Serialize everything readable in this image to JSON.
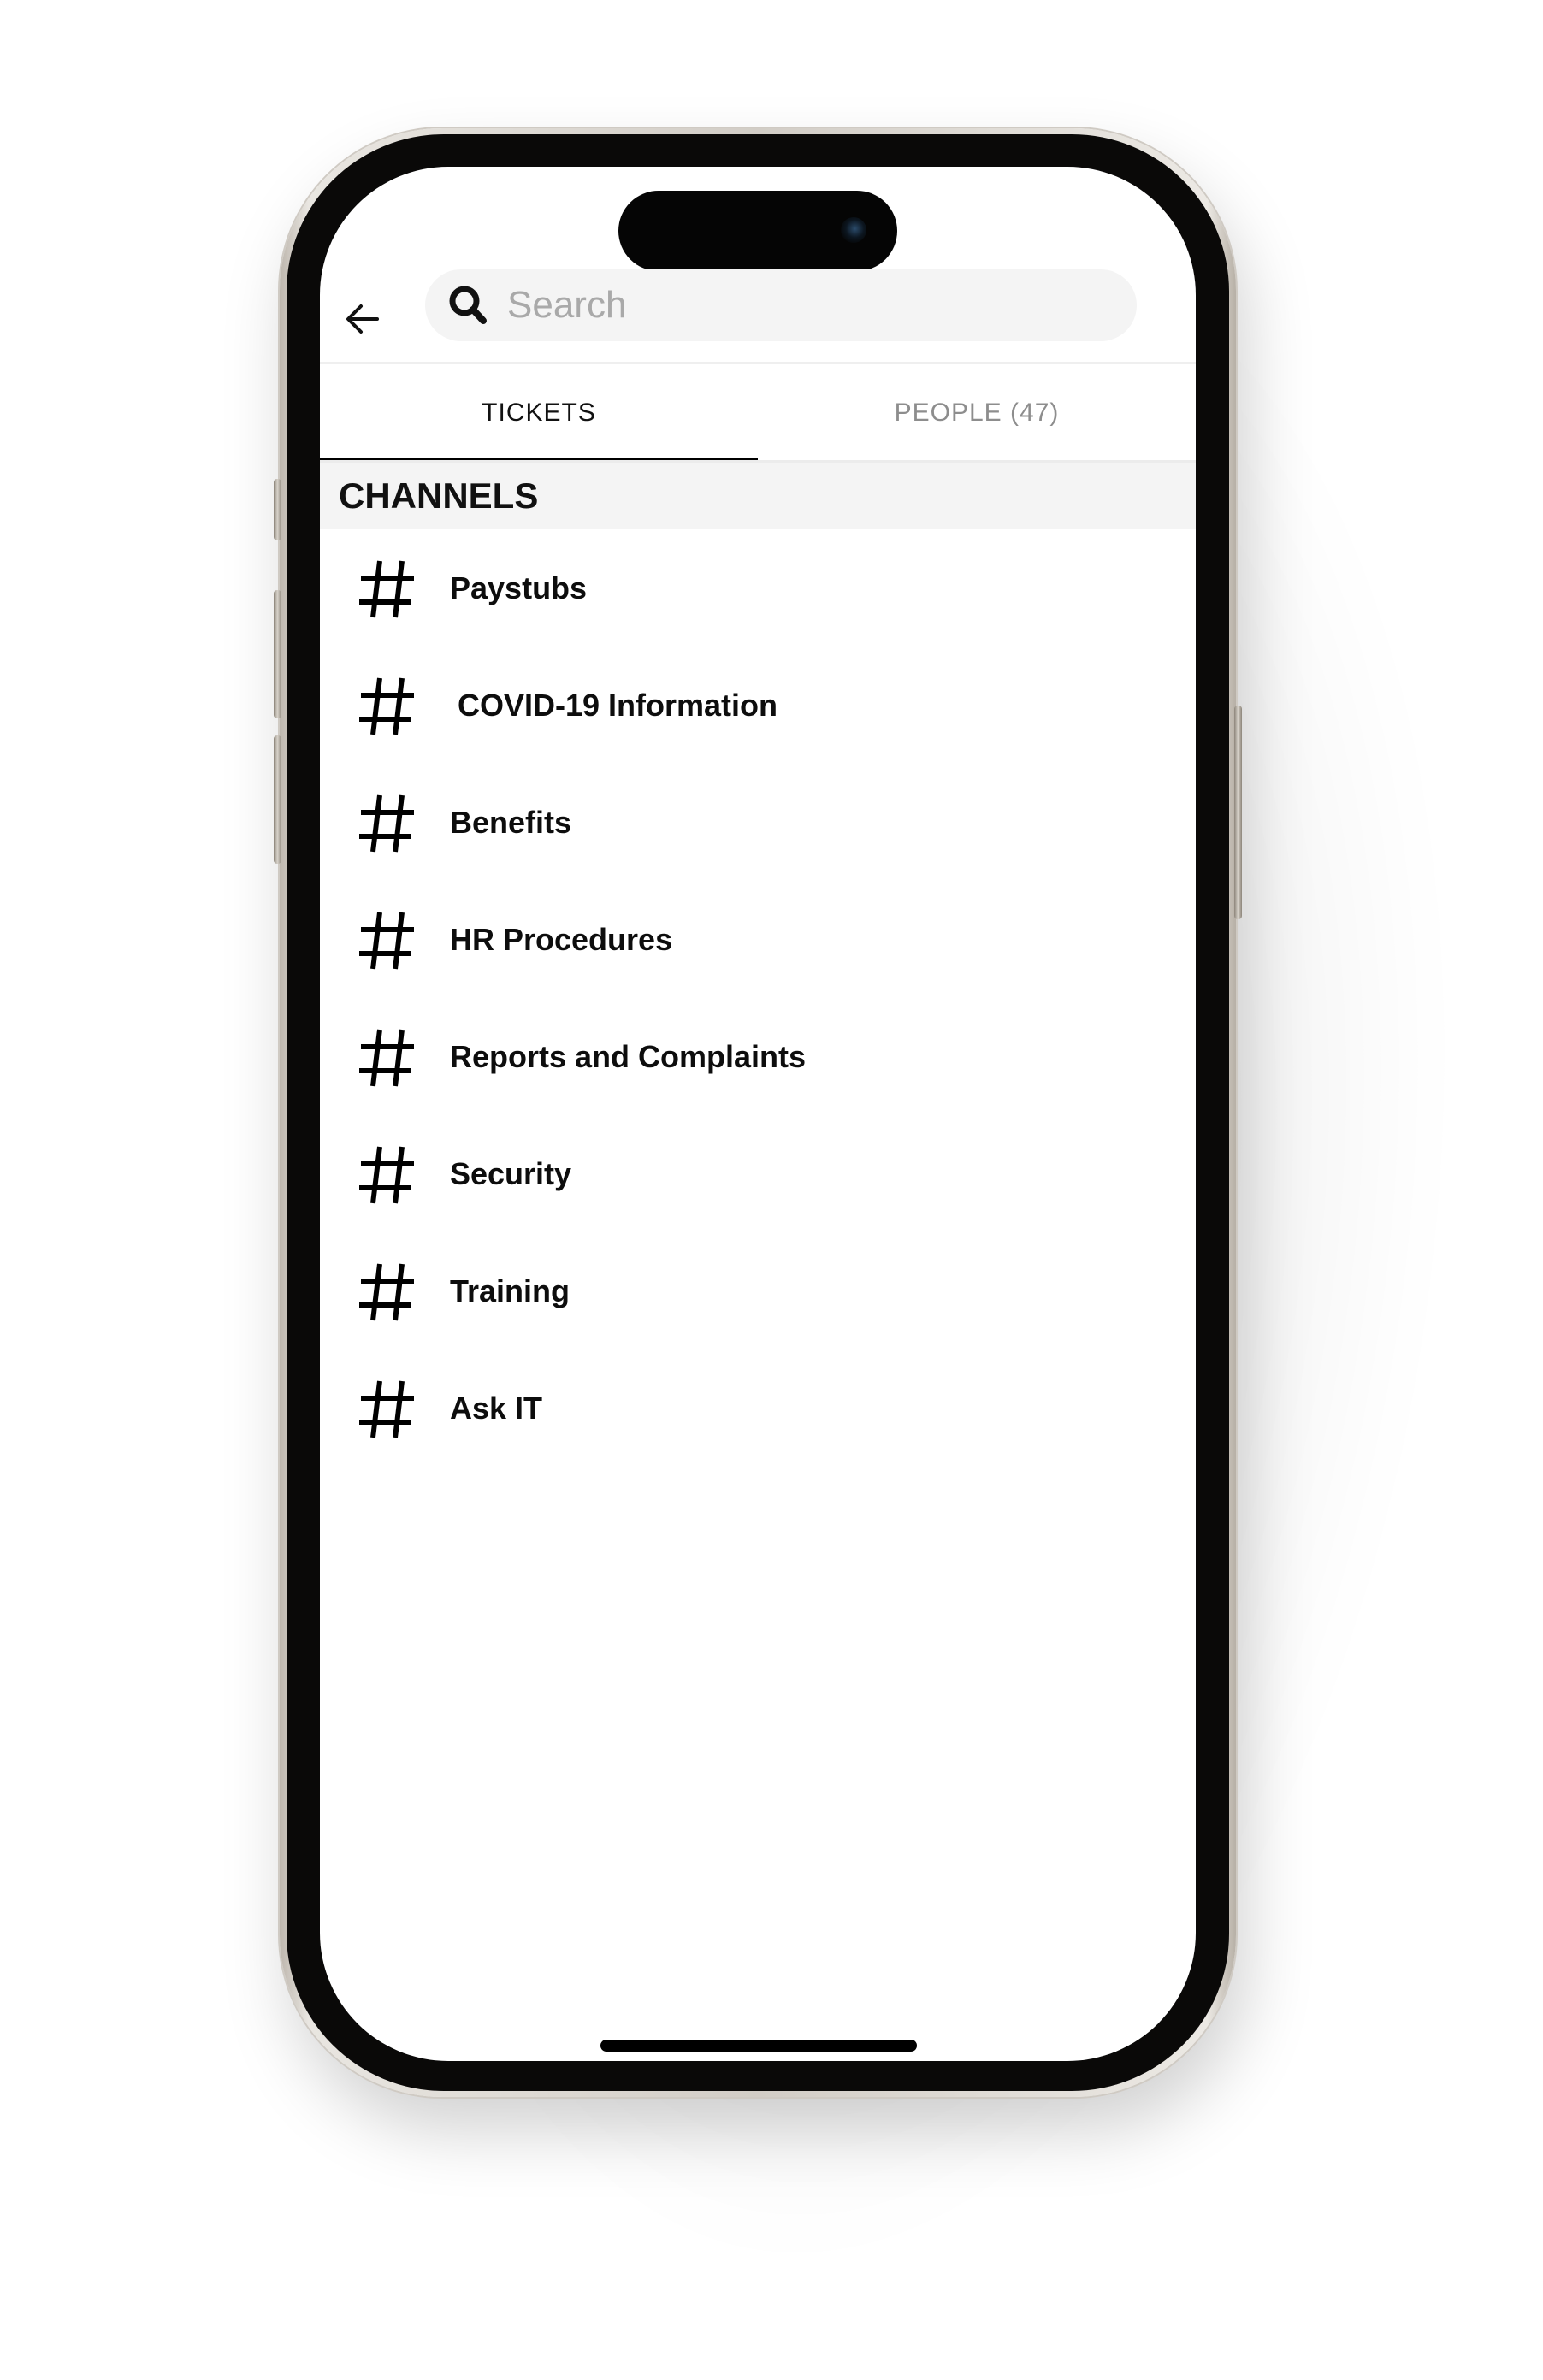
{
  "search": {
    "placeholder": "Search",
    "value": "",
    "icon": "search-icon"
  },
  "navigation": {
    "back_icon": "arrow-left-icon"
  },
  "tabs": [
    {
      "label": "TICKETS",
      "active": true
    },
    {
      "label": "PEOPLE (47)",
      "active": false
    }
  ],
  "section": {
    "title": "CHANNELS"
  },
  "channels": [
    {
      "icon": "hash-icon",
      "label": "Paystubs"
    },
    {
      "icon": "hash-icon",
      "label": "COVID-19 Information"
    },
    {
      "icon": "hash-icon",
      "label": "Benefits"
    },
    {
      "icon": "hash-icon",
      "label": "HR Procedures"
    },
    {
      "icon": "hash-icon",
      "label": "Reports and Complaints"
    },
    {
      "icon": "hash-icon",
      "label": "Security"
    },
    {
      "icon": "hash-icon",
      "label": "Training"
    },
    {
      "icon": "hash-icon",
      "label": "Ask IT"
    }
  ],
  "colors": {
    "text_primary": "#111111",
    "text_muted": "#8d8d8d",
    "search_bg": "#f4f4f4",
    "section_bg": "#f4f4f4",
    "active_tab_indicator": "#000000"
  }
}
